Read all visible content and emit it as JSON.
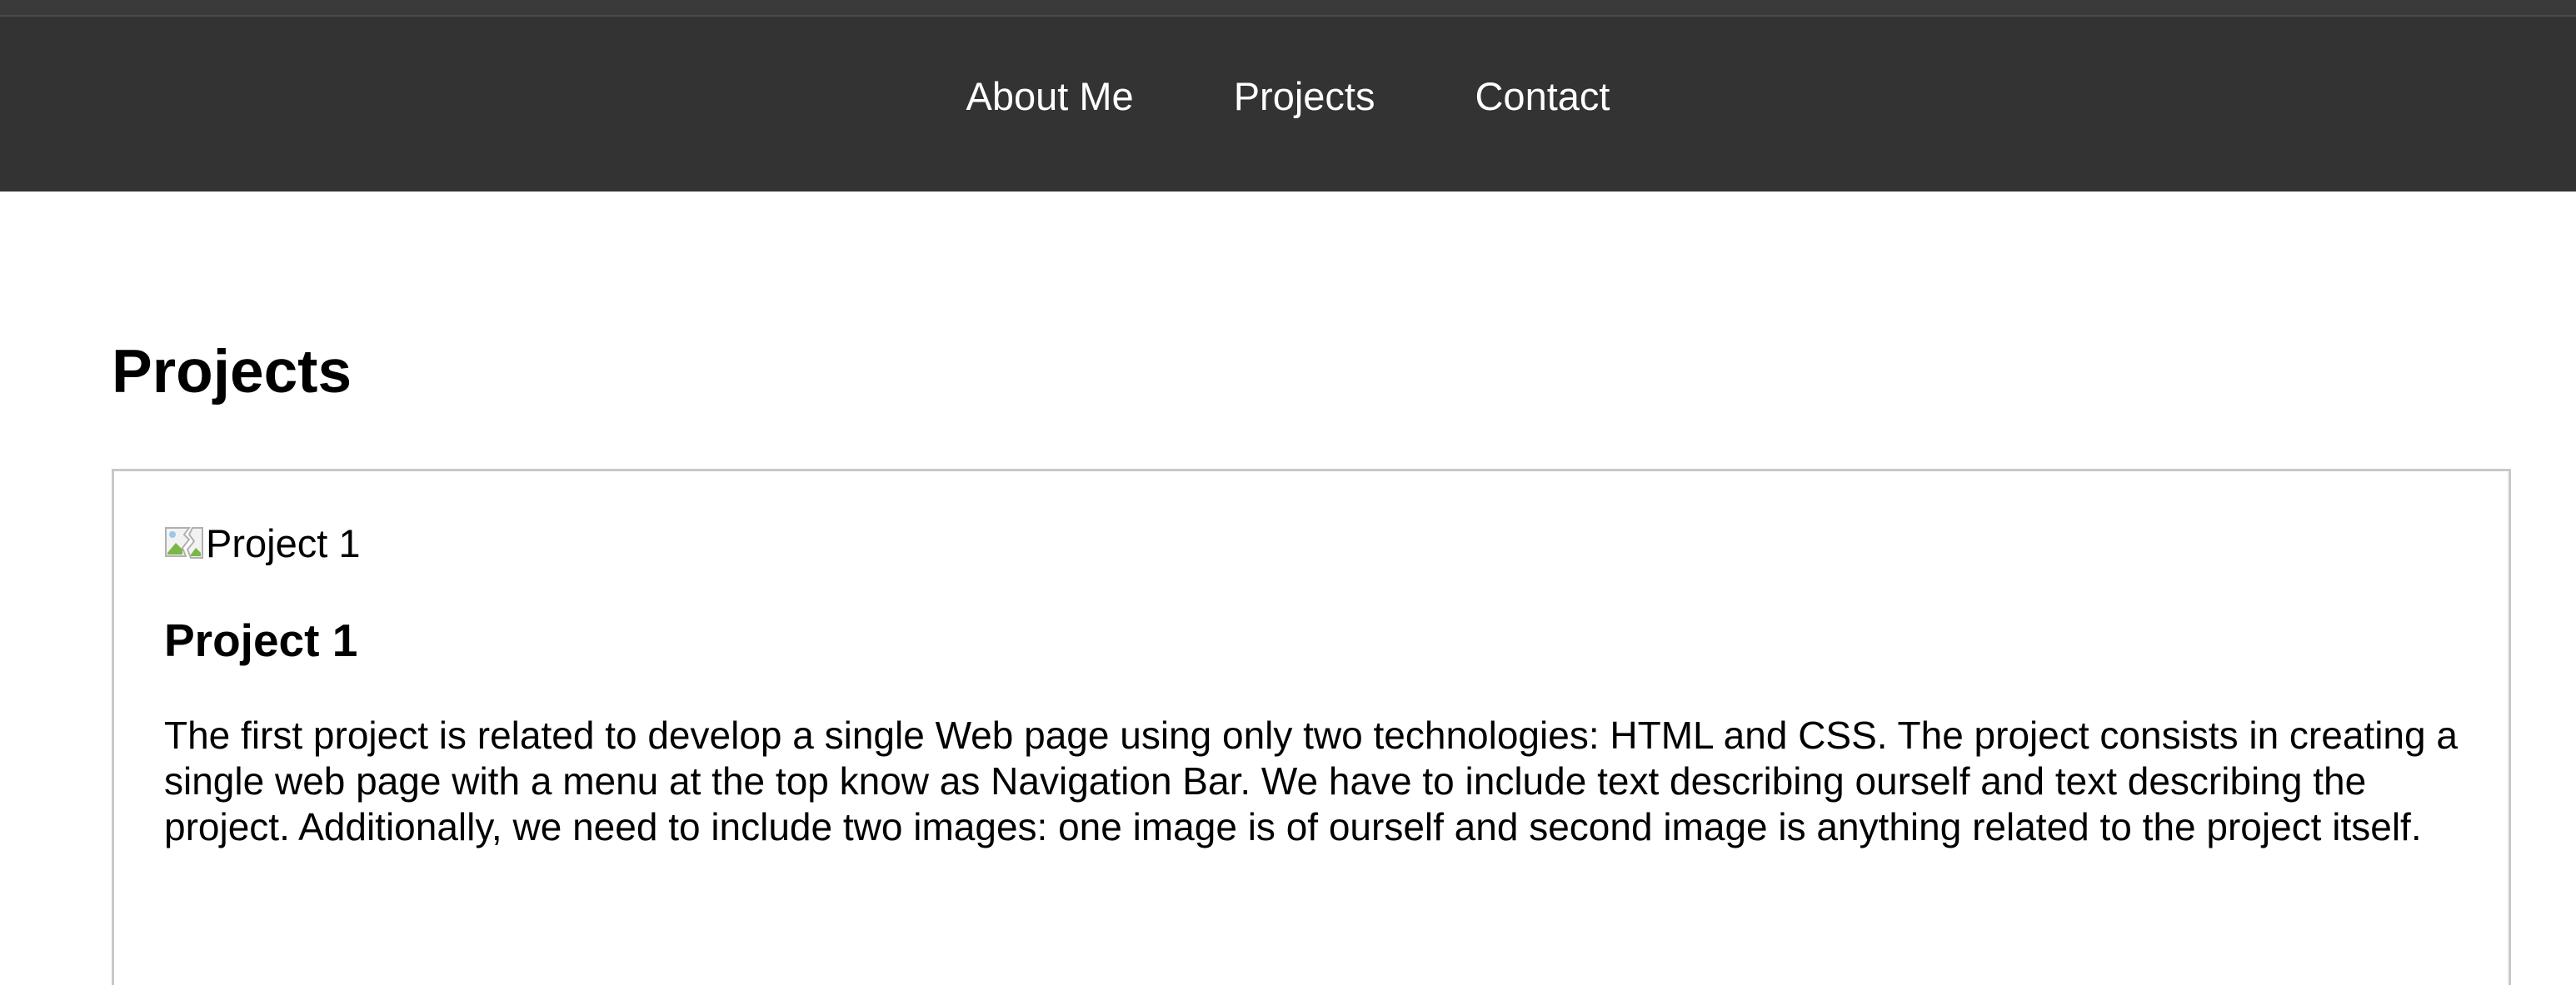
{
  "nav": {
    "items": [
      {
        "label": "About Me"
      },
      {
        "label": "Projects"
      },
      {
        "label": "Contact"
      }
    ]
  },
  "main": {
    "section_title": "Projects",
    "projects": [
      {
        "image_alt": "Project 1",
        "image_icon": "broken-image-icon",
        "title": "Project 1",
        "description": "The first project is related to develop a single Web page using only two technologies: HTML and CSS. The project consists in creating a single web page with a menu at the top know as Navigation Bar. We have to include text describing ourself and text describing the project. Additionally, we need to include two images: one image is of ourself and second image is anything related to the project itself."
      }
    ]
  },
  "colors": {
    "navbar_bg": "#333333",
    "nav_text": "#ffffff",
    "card_border": "#c8c8c8"
  }
}
